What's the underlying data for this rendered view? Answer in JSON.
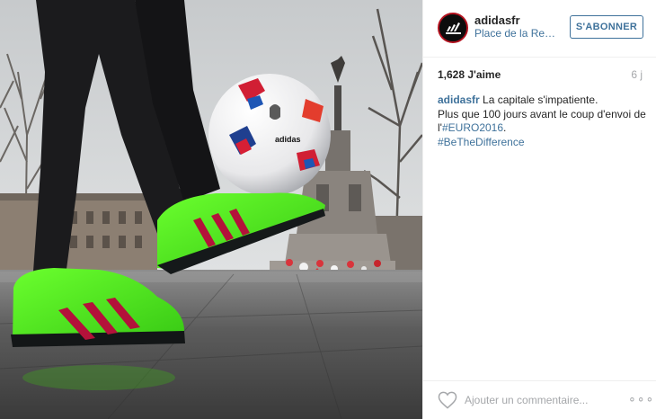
{
  "post": {
    "photo": {
      "description_icon": "photo-adidas-football"
    },
    "header": {
      "username": "adidasfr",
      "location": "Place de la Rep...",
      "follow_label": "S'ABONNER",
      "avatar_icon": "adidas-logo-icon"
    },
    "stats": {
      "likes": "1,628 J'aime",
      "time": "6 j"
    },
    "caption": {
      "username": "adidasfr",
      "line1": "La capitale s'impatiente.",
      "line2": "Plus que 100 jours avant le coup d'envoi de l'",
      "hashtag_euro": "#EURO2016",
      "after_euro": ".",
      "hashtag_diff": "#BeTheDifference"
    },
    "footer": {
      "heart_icon": "heart-icon",
      "comment_placeholder": "Ajouter un commentaire...",
      "more_label": "∘∘∘"
    },
    "colors": {
      "link": "#3f729b",
      "text": "#262626",
      "muted": "#a5a7aa",
      "boot_green": "#4ef01e",
      "boot_stripes": "#b3123a",
      "avatar_ring": "#b3121f"
    }
  }
}
